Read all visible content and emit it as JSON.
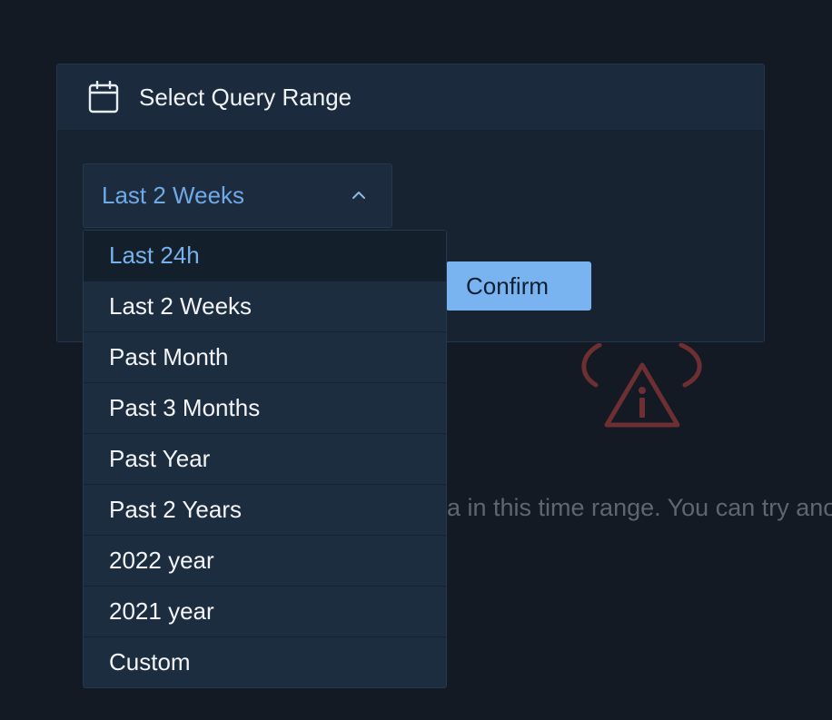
{
  "modal": {
    "title": "Select Query Range",
    "icon": "calendar-icon"
  },
  "range_select": {
    "value": "Last 2 Weeks",
    "icon": "chevron-up-icon",
    "options": [
      "Last 24h",
      "Last 2 Weeks",
      "Past Month",
      "Past 3 Months",
      "Past Year",
      "Past 2 Years",
      "2022 year",
      "2021 year",
      "Custom"
    ],
    "highlighted_option": "Last 24h"
  },
  "confirm": {
    "label": "Confirm"
  },
  "empty_state": {
    "icon": "cloud-warning-icon",
    "message_visible": "a in this time range. You can try anot"
  },
  "colors": {
    "background": "#131a23",
    "modal": "#172330",
    "accent": "#79b4f0",
    "warning": "#6e2f33"
  }
}
